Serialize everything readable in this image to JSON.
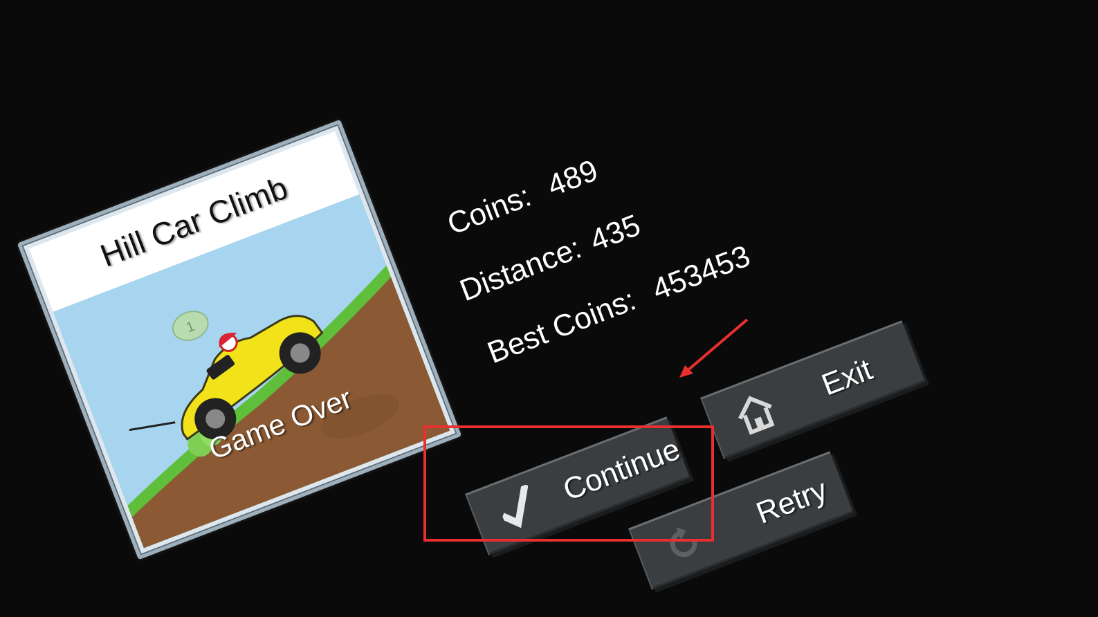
{
  "card": {
    "title": "Hill Car Climb",
    "status": "Game Over",
    "coin_icon_number": "1"
  },
  "stats": {
    "coins_label": "Coins:",
    "coins_value": "489",
    "distance_label": "Distance:",
    "distance_value": "435",
    "best_coins_label": "Best Coins:",
    "best_coins_value": "453453"
  },
  "buttons": {
    "continue_label": "Continue",
    "exit_label": "Exit",
    "retry_label": "Retry"
  },
  "icons": {
    "continue": "checkmark-icon",
    "exit": "home-icon",
    "retry": "retry-icon"
  },
  "colors": {
    "background": "#0a0a0a",
    "button": "#3a3e40",
    "highlight": "#e8302f",
    "sky": "#a7d4ef",
    "grass": "#5fbf3a",
    "dirt": "#8b5a34",
    "car": "#f2e21a"
  }
}
